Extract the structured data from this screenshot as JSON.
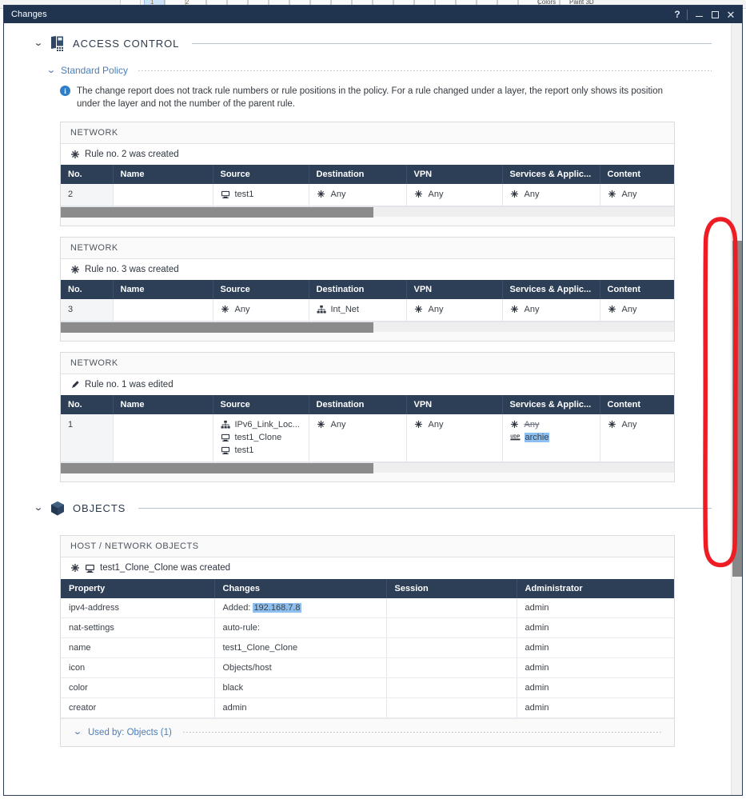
{
  "window": {
    "title": "Changes",
    "controls": {
      "help": "?",
      "minimize": "minimize-button",
      "maximize": "maximize-button",
      "close": "close-button"
    }
  },
  "background_app": {
    "labels": [
      "Colors",
      "Paint 3D"
    ],
    "numbers": [
      "1",
      "2"
    ]
  },
  "sections": [
    {
      "id": "access-control",
      "title": "ACCESS CONTROL",
      "icon": "access-control-icon",
      "expanded": true,
      "policy": {
        "name": "Standard Policy",
        "expanded": true
      },
      "note": {
        "icon": "info-icon",
        "text": "The change report does not track rule numbers or rule positions in the policy. For a rule changed under a layer, the report only shows its position under the layer and not the number of the parent rule."
      }
    },
    {
      "id": "objects",
      "title": "OBJECTS",
      "icon": "objects-cube-icon",
      "expanded": true
    }
  ],
  "rule_cards": [
    {
      "layer": "NETWORK",
      "change_icon": "star-created-icon",
      "change_text": "Rule no. 2 was created",
      "columns": [
        "No.",
        "Name",
        "Source",
        "Destination",
        "VPN",
        "Services & Applic...",
        "Content"
      ],
      "row": {
        "no": "2",
        "name": "",
        "source": [
          {
            "icon": "host-icon",
            "text": "test1",
            "strike": false,
            "highlight": false
          }
        ],
        "destination": [
          {
            "icon": "any-asterisk-icon",
            "text": "Any",
            "strike": false,
            "highlight": false
          }
        ],
        "vpn": [
          {
            "icon": "any-asterisk-icon",
            "text": "Any",
            "strike": false,
            "highlight": false
          }
        ],
        "services": [
          {
            "icon": "any-asterisk-icon",
            "text": "Any",
            "strike": false,
            "highlight": false
          }
        ],
        "content": [
          {
            "icon": "any-asterisk-icon",
            "text": "Any",
            "strike": false,
            "highlight": false
          }
        ]
      },
      "hscroll_thumb_pct": 51
    },
    {
      "layer": "NETWORK",
      "change_icon": "star-created-icon",
      "change_text": "Rule no. 3 was created",
      "columns": [
        "No.",
        "Name",
        "Source",
        "Destination",
        "VPN",
        "Services & Applic...",
        "Content"
      ],
      "row": {
        "no": "3",
        "name": "",
        "source": [
          {
            "icon": "any-asterisk-icon",
            "text": "Any",
            "strike": false,
            "highlight": false
          }
        ],
        "destination": [
          {
            "icon": "network-icon",
            "text": "Int_Net",
            "strike": false,
            "highlight": false
          }
        ],
        "vpn": [
          {
            "icon": "any-asterisk-icon",
            "text": "Any",
            "strike": false,
            "highlight": false
          }
        ],
        "services": [
          {
            "icon": "any-asterisk-icon",
            "text": "Any",
            "strike": false,
            "highlight": false
          }
        ],
        "content": [
          {
            "icon": "any-asterisk-icon",
            "text": "Any",
            "strike": false,
            "highlight": false
          }
        ]
      },
      "hscroll_thumb_pct": 51
    },
    {
      "layer": "NETWORK",
      "change_icon": "pencil-edited-icon",
      "change_text": "Rule no. 1 was edited",
      "columns": [
        "No.",
        "Name",
        "Source",
        "Destination",
        "VPN",
        "Services & Applic...",
        "Content"
      ],
      "row": {
        "no": "1",
        "name": "",
        "source": [
          {
            "icon": "network-icon",
            "text": "IPv6_Link_Loc...",
            "strike": false,
            "highlight": false
          },
          {
            "icon": "host-icon",
            "text": "test1_Clone",
            "strike": false,
            "highlight": false
          },
          {
            "icon": "host-icon",
            "text": "test1",
            "strike": false,
            "highlight": false
          }
        ],
        "destination": [
          {
            "icon": "any-asterisk-icon",
            "text": "Any",
            "strike": false,
            "highlight": false
          }
        ],
        "vpn": [
          {
            "icon": "any-asterisk-icon",
            "text": "Any",
            "strike": false,
            "highlight": false
          }
        ],
        "services": [
          {
            "icon": "any-asterisk-icon",
            "text": "Any",
            "strike": true,
            "highlight": false
          },
          {
            "icon": "udp-service-icon",
            "text": "archie",
            "strike": false,
            "highlight": true
          }
        ],
        "content": [
          {
            "icon": "any-asterisk-icon",
            "text": "Any",
            "strike": false,
            "highlight": false
          }
        ]
      },
      "hscroll_thumb_pct": 51
    }
  ],
  "objects_card": {
    "header": "HOST / NETWORK OBJECTS",
    "change_icon": "star-created-icon",
    "object_icon": "host-icon",
    "change_text": "test1_Clone_Clone was created",
    "columns": [
      "Property",
      "Changes",
      "Session",
      "Administrator"
    ],
    "rows": [
      {
        "property": "ipv4-address",
        "changes_prefix": "Added:",
        "changes_value": "192.168.7.8",
        "highlight": true,
        "session": "",
        "administrator": "admin"
      },
      {
        "property": "nat-settings",
        "changes_prefix": "auto-rule:",
        "changes_value": "",
        "highlight": false,
        "session": "",
        "administrator": "admin"
      },
      {
        "property": "name",
        "changes_prefix": "test1_Clone_Clone",
        "changes_value": "",
        "highlight": false,
        "session": "",
        "administrator": "admin"
      },
      {
        "property": "icon",
        "changes_prefix": "Objects/host",
        "changes_value": "",
        "highlight": false,
        "session": "",
        "administrator": "admin"
      },
      {
        "property": "color",
        "changes_prefix": "black",
        "changes_value": "",
        "highlight": false,
        "session": "",
        "administrator": "admin"
      },
      {
        "property": "creator",
        "changes_prefix": "admin",
        "changes_value": "",
        "highlight": false,
        "session": "",
        "administrator": "admin"
      }
    ],
    "used_by": "Used by: Objects (1)"
  },
  "annotation": {
    "shape": "red-oval-highlight",
    "target": "vertical-scrollbar",
    "color": "#ee1c24"
  },
  "colors": {
    "titlebar": "#20334f",
    "table_header": "#2d3e57",
    "link": "#4a7ebb",
    "highlight": "#8dc0f0",
    "scrollbar_thumb": "#888888",
    "annotation": "#ee1c24"
  }
}
